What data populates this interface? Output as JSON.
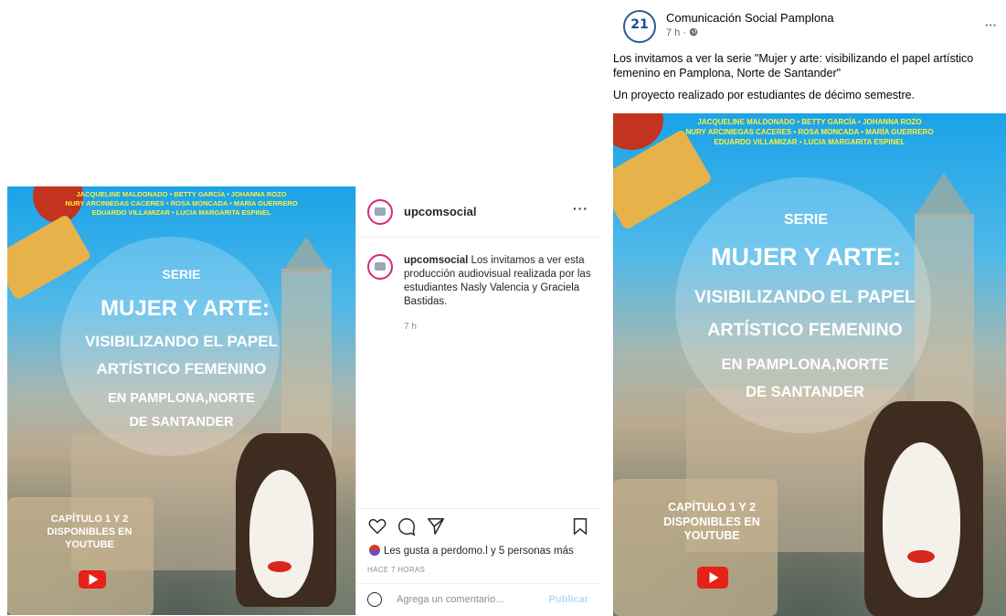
{
  "instagram": {
    "username": "upcomsocial",
    "more": "···",
    "caption_user": "upcomsocial",
    "caption_text": "Los invitamos a ver esta producción audiovisual realizada por las estudiantes Nasly Valencia y Graciela Bastidas.",
    "time": "7 h",
    "likes_text": "Les gusta a perdomo.l y 5 personas más",
    "ago": "HACE 7 HORAS",
    "comment_placeholder": "Agrega un comentario...",
    "publish_label": "Publicar"
  },
  "facebook": {
    "page_name": "Comunicación Social Pamplona",
    "meta": "7 h · ",
    "avatar_text": "21",
    "more": "···",
    "text_line1": "Los invitamos a ver la serie  \"Mujer y arte: visibilizando el papel artístico femenino en Pamplona, Norte de Santander\"",
    "text_line2": "Un proyecto realizado por estudiantes de décimo semestre."
  },
  "poster": {
    "names_line1": "JACQUELINE MALDONADO  •  BETTY GARCÍA  •  JOHANNA ROZO",
    "names_line2": "NURY ARCINIEGAS CACERES • ROSA MONCADA • MARÍA GUERRERO",
    "names_line3": "EDUARDO VILLAMIZAR  •  LUCIA MARGARITA ESPINEL",
    "serie": "SERIE",
    "title1": "MUJER Y ARTE:",
    "title2": "VISIBILIZANDO EL PAPEL",
    "title3": "ARTÍSTICO FEMENINO",
    "title4": "EN PAMPLONA,NORTE",
    "title5": "DE SANTANDER",
    "chapter1": "CAPÍTULO 1 Y 2",
    "chapter2": "DISPONIBLES EN",
    "chapter3": "YOUTUBE"
  },
  "colors": {
    "names": "#ffef3a",
    "youtube_red": "#e62117",
    "ig_gradient": "#d62976",
    "publish": "#b3dbff"
  }
}
